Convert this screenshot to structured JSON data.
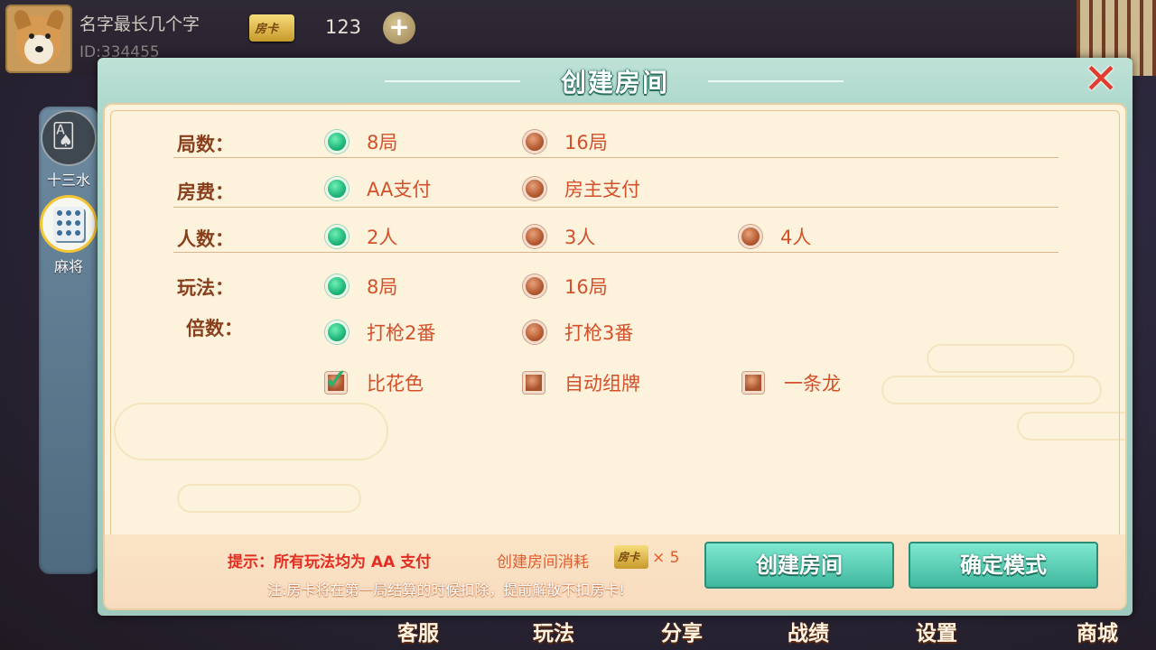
{
  "user": {
    "name": "名字最长几个字",
    "id_text": "ID:334455",
    "card_label": "房卡",
    "card_count": "123",
    "add_symbol": "+"
  },
  "games": [
    {
      "label": "十三水",
      "selected": false,
      "icon": "playing-cards-icon"
    },
    {
      "label": "麻将",
      "selected": true,
      "icon": "mahjong-tile-icon"
    }
  ],
  "dialog": {
    "title": "创建房间",
    "close_symbol": "✕",
    "rows": [
      {
        "label": "局数：",
        "options": [
          {
            "text": "8局",
            "selected": true
          },
          {
            "text": "16局",
            "selected": false
          }
        ]
      },
      {
        "label": "房费：",
        "options": [
          {
            "text": "AA支付",
            "selected": true
          },
          {
            "text": "房主支付",
            "selected": false
          }
        ]
      },
      {
        "label": "人数：",
        "options": [
          {
            "text": "2人",
            "selected": true
          },
          {
            "text": "3人",
            "selected": false
          },
          {
            "text": "4人",
            "selected": false
          }
        ]
      },
      {
        "label": "玩法：",
        "options": [
          {
            "text": "8局",
            "selected": true
          },
          {
            "text": "16局",
            "selected": false
          }
        ]
      },
      {
        "label": "倍数：",
        "options": [
          {
            "text": "打枪2番",
            "selected": true
          },
          {
            "text": "打枪3番",
            "selected": false
          }
        ]
      }
    ],
    "checkboxes": [
      {
        "text": "比花色",
        "checked": true
      },
      {
        "text": "自动组牌",
        "checked": false
      },
      {
        "text": "一条龙",
        "checked": false
      }
    ],
    "footer": {
      "tip": "提示：所有玩法均为 AA 支付",
      "cost_label": "创建房间消耗",
      "cost_chip": "房卡",
      "cost_multiplier": "× 5",
      "note": "注:房卡将在第一局结算的时候扣除，提前解散不扣房卡!",
      "create_button": "创建房间",
      "confirm_button": "确定模式"
    }
  },
  "bottom_nav": [
    {
      "label": "客服",
      "icon": "headset-icon"
    },
    {
      "label": "玩法",
      "icon": "book-icon"
    },
    {
      "label": "分享",
      "icon": "share-icon"
    },
    {
      "label": "战绩",
      "icon": "trophy-icon"
    },
    {
      "label": "设置",
      "icon": "gear-icon"
    },
    {
      "label": "商城",
      "icon": "shop-icon"
    }
  ],
  "colors": {
    "accent_green": "#1fb67a",
    "option_text": "#d2502a",
    "label_text": "#8a3f1c",
    "button_teal": "#3fb89e",
    "tip_red": "#e22d20"
  }
}
